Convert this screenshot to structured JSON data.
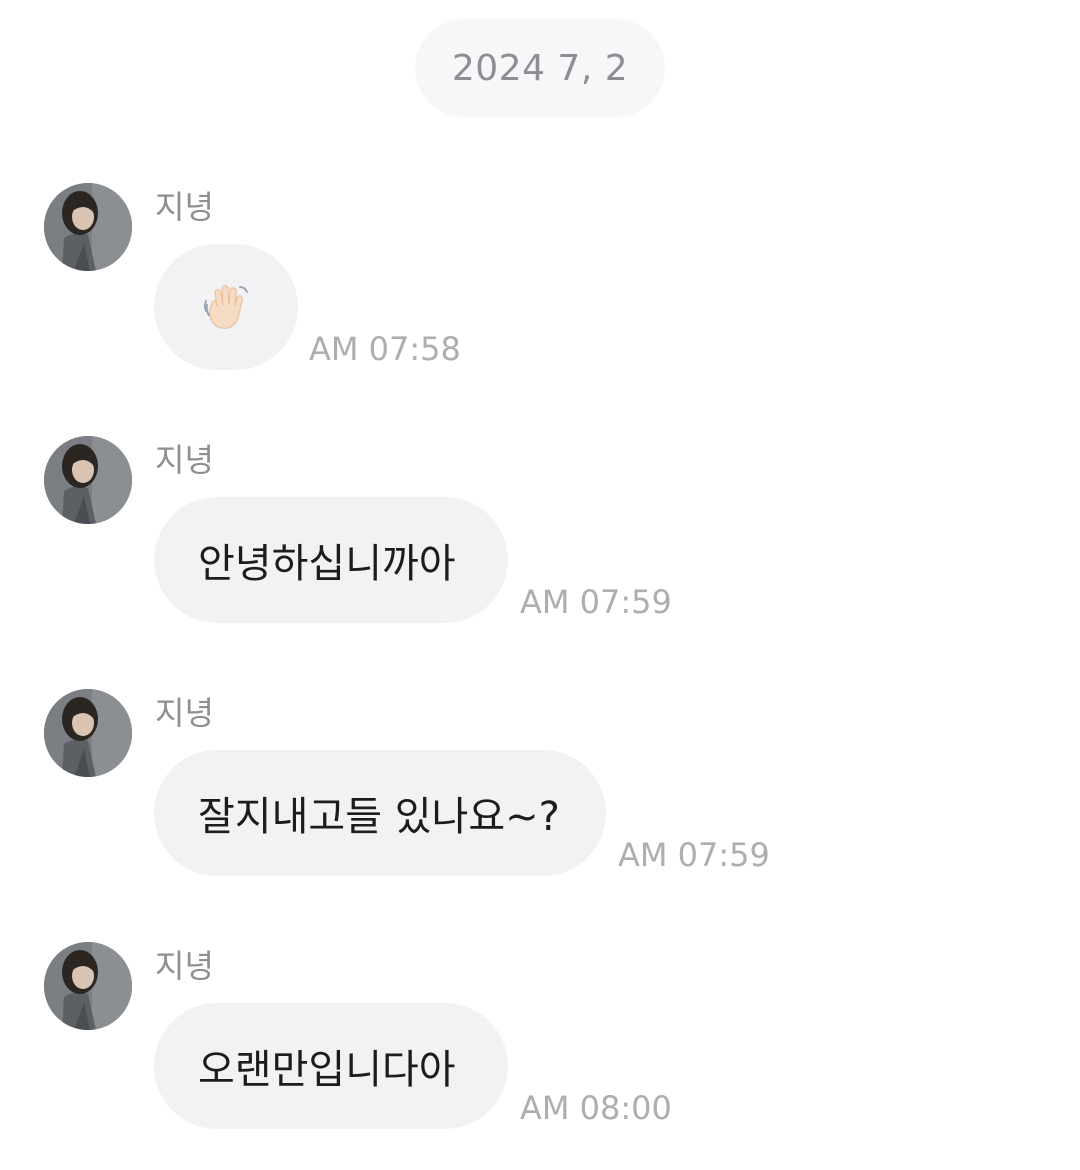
{
  "chat": {
    "date_label": "2024 7, 2",
    "messages": [
      {
        "sender": "지녕",
        "text": "",
        "emoji": "waving-hand",
        "time": "AM 07:58"
      },
      {
        "sender": "지녕",
        "text": "안녕하십니까아",
        "time": "AM 07:59"
      },
      {
        "sender": "지녕",
        "text": "잘지내고들 있나요~?",
        "time": "AM 07:59"
      },
      {
        "sender": "지녕",
        "text": "오랜만입니다아",
        "time": "AM 08:00"
      }
    ]
  },
  "colors": {
    "bubble_bg": "#f2f2f4",
    "date_pill_bg": "#f7f7f9",
    "meta_text": "#8e8e93",
    "timestamp_text": "#aeaeb2"
  }
}
